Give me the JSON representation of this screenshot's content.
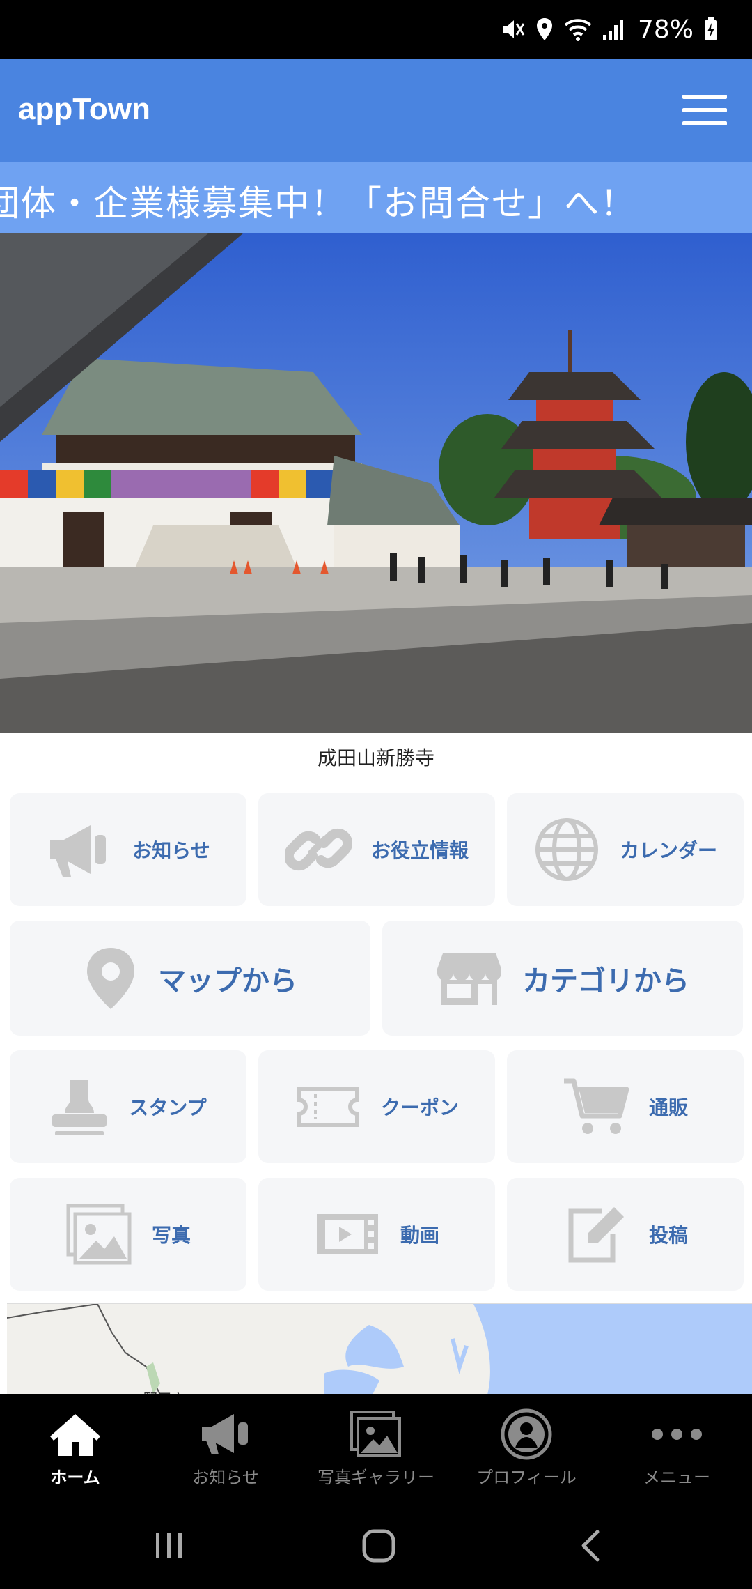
{
  "status_bar": {
    "battery": "78%"
  },
  "header": {
    "title": "appTown"
  },
  "marquee": {
    "text": "団体・企業様募集中！「お問合せ」へ！"
  },
  "hero": {
    "caption": "成田山新勝寺"
  },
  "tiles": [
    {
      "label": "お知らせ",
      "icon": "megaphone-icon"
    },
    {
      "label": "お役立情報",
      "icon": "link-icon"
    },
    {
      "label": "カレンダー",
      "icon": "globe-icon"
    },
    {
      "label": "マップから",
      "icon": "map-pin-icon"
    },
    {
      "label": "カテゴリから",
      "icon": "store-icon"
    },
    {
      "label": "スタンプ",
      "icon": "stamp-icon"
    },
    {
      "label": "クーポン",
      "icon": "ticket-icon"
    },
    {
      "label": "通販",
      "icon": "cart-icon"
    },
    {
      "label": "写真",
      "icon": "photo-icon"
    },
    {
      "label": "動画",
      "icon": "video-icon"
    },
    {
      "label": "投稿",
      "icon": "edit-icon"
    }
  ],
  "map": {
    "place_label": "野田市"
  },
  "bottom_nav": [
    {
      "label": "ホーム",
      "icon": "home-icon",
      "active": true
    },
    {
      "label": "お知らせ",
      "icon": "megaphone-icon",
      "active": false
    },
    {
      "label": "写真ギャラリー",
      "icon": "gallery-icon",
      "active": false
    },
    {
      "label": "プロフィール",
      "icon": "profile-icon",
      "active": false
    },
    {
      "label": "メニュー",
      "icon": "more-icon",
      "active": false
    }
  ],
  "colors": {
    "header_bg": "#4A84E0",
    "marquee_bg": "#6FA2F2",
    "tile_bg": "#F5F6F8",
    "tile_text": "#3C6BAF",
    "tile_icon": "#C8C8C8"
  }
}
